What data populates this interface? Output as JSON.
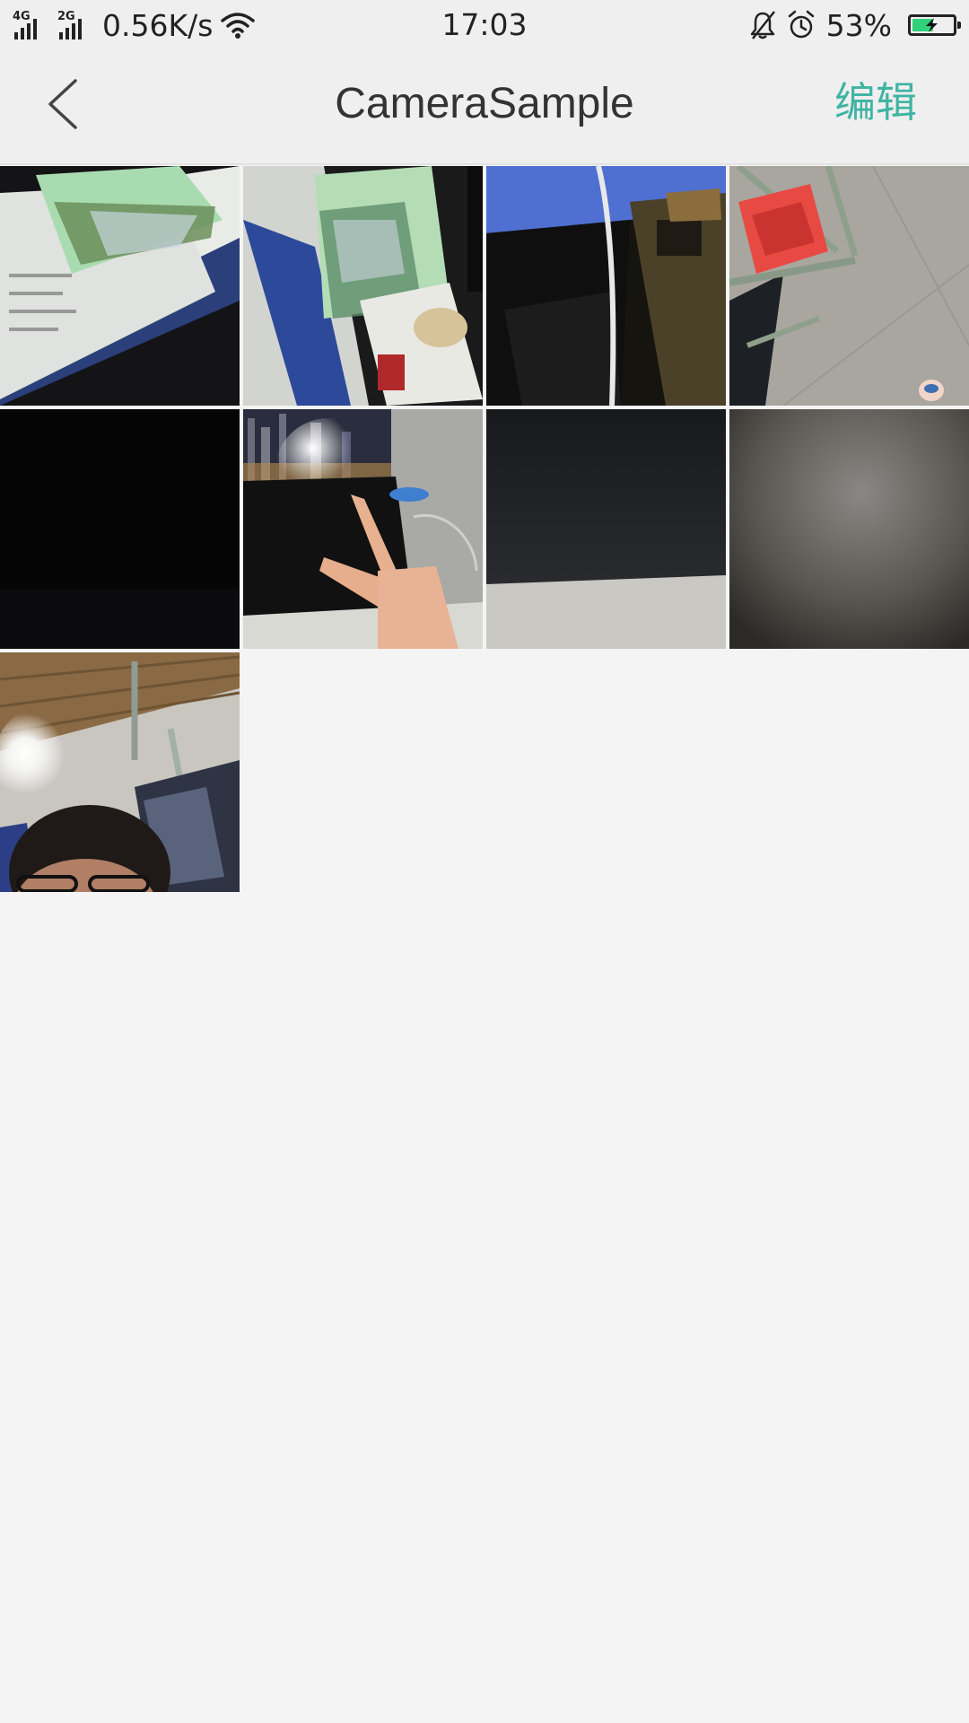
{
  "status_bar": {
    "network_1": "4G",
    "network_2": "2G",
    "speed": "0.56K/s",
    "time": "17:03",
    "battery": "53%",
    "battery_level": 0.53,
    "battery_color": "#2fd27a",
    "icons": [
      "signal-4g-icon",
      "signal-2g-icon",
      "wifi-icon",
      "bell-muted-icon",
      "alarm-icon",
      "battery-charging-icon"
    ]
  },
  "header": {
    "title": "CameraSample",
    "edit_label": "编辑",
    "accent_color": "#3fb4a2",
    "back_icon": "chevron-left-icon"
  },
  "gallery": {
    "photo_count": 9
  }
}
